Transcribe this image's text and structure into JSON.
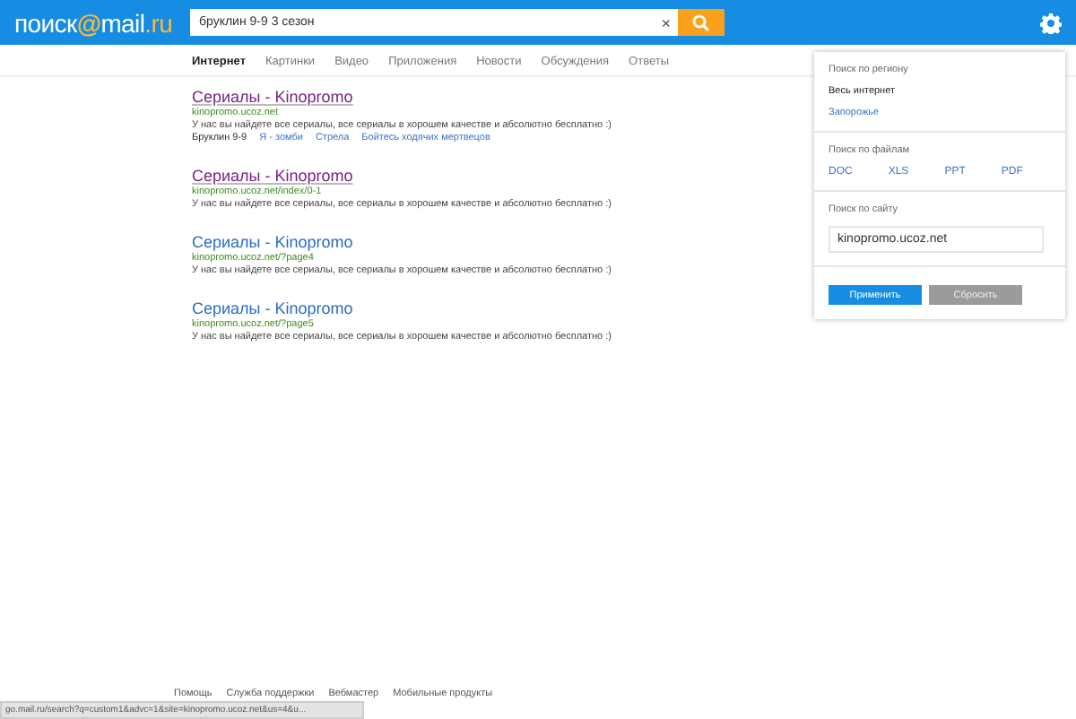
{
  "header": {
    "logo": {
      "left": "поиск",
      "at": "@",
      "right": "mail",
      "ru": ".ru"
    },
    "search": {
      "value": "бруклин 9-9 3 сезон",
      "clear": "×"
    }
  },
  "tabs": [
    {
      "label": "Интернет",
      "selected": true
    },
    {
      "label": "Картинки",
      "selected": false
    },
    {
      "label": "Видео",
      "selected": false
    },
    {
      "label": "Приложения",
      "selected": false
    },
    {
      "label": "Новости",
      "selected": false
    },
    {
      "label": "Обсуждения",
      "selected": false
    },
    {
      "label": "Ответы",
      "selected": false
    }
  ],
  "results": [
    {
      "title": "Сериалы - Kinopromo",
      "visited": true,
      "url": "kinopromo.ucoz.net",
      "snippet": "У нас вы найдете все сериалы, все сериалы в хорошем качестве и абсолютно бесплатно :)",
      "sitelinks": [
        "Бруклин 9-9",
        "Я - зомби",
        "Стрела",
        "Бойтесь ходячих мертвецов"
      ]
    },
    {
      "title": "Сериалы - Kinopromo",
      "visited": true,
      "url": "kinopromo.ucoz.net/index/0-1",
      "snippet": "У нас вы найдете все сериалы, все сериалы в хорошем качестве и абсолютно бесплатно :)"
    },
    {
      "title": "Сериалы - Kinopromo",
      "visited": false,
      "url": "kinopromo.ucoz.net/?page4",
      "snippet": "У нас вы найдете все сериалы, все сериалы в хорошем качестве и абсолютно бесплатно :)"
    },
    {
      "title": "Сериалы - Kinopromo",
      "visited": false,
      "url": "kinopromo.ucoz.net/?page5",
      "snippet": "У нас вы найдете все сериалы, все сериалы в хорошем качестве и абсолютно бесплатно :)"
    }
  ],
  "settings_panel": {
    "region": {
      "heading": "Поиск по региону",
      "options": [
        {
          "label": "Весь интернет",
          "selected": true
        },
        {
          "label": "Запорожье",
          "selected": false
        }
      ]
    },
    "files": {
      "heading": "Поиск по файлам",
      "types": [
        "DOC",
        "XLS",
        "PPT",
        "PDF"
      ]
    },
    "site": {
      "heading": "Поиск по сайту",
      "value": "kinopromo.ucoz.net"
    },
    "buttons": [
      {
        "label": "Применить",
        "kind": "primary"
      },
      {
        "label": "Сбросить",
        "kind": "secondary"
      }
    ]
  },
  "footer": [
    "Помощь",
    "Служба поддержки",
    "Вебмастер",
    "Мобильные продукты"
  ],
  "status_bar": "go.mail.ru/search?q=custom1&advc=1&site=kinopromo.ucoz.net&us=4&u..."
}
